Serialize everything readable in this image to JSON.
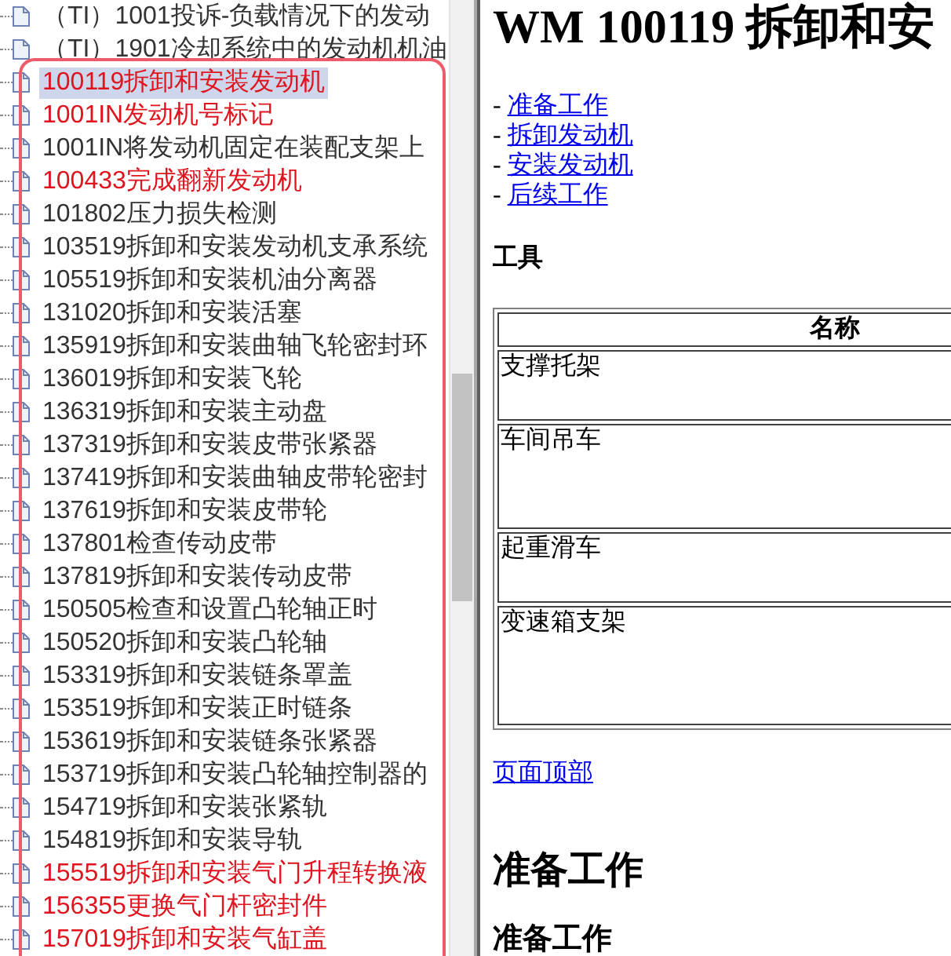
{
  "tree": {
    "items": [
      {
        "text": "（TI）1001投诉-负载情况下的发动",
        "color": "#333333",
        "selected": false
      },
      {
        "text": "（TI）1901冷却系统中的发动机机油",
        "color": "#333333",
        "selected": false
      },
      {
        "text": "100119拆卸和安装发动机",
        "color": "#e0141e",
        "selected": true
      },
      {
        "text": "1001IN发动机号标记",
        "color": "#e0141e",
        "selected": false
      },
      {
        "text": "1001IN将发动机固定在装配支架上",
        "color": "#333333",
        "selected": false
      },
      {
        "text": "100433完成翻新发动机",
        "color": "#e0141e",
        "selected": false
      },
      {
        "text": "101802压力损失检测",
        "color": "#333333",
        "selected": false
      },
      {
        "text": "103519拆卸和安装发动机支承系统",
        "color": "#333333",
        "selected": false
      },
      {
        "text": "105519拆卸和安装机油分离器",
        "color": "#333333",
        "selected": false
      },
      {
        "text": "131020拆卸和安装活塞",
        "color": "#333333",
        "selected": false
      },
      {
        "text": "135919拆卸和安装曲轴飞轮密封环",
        "color": "#333333",
        "selected": false
      },
      {
        "text": "136019拆卸和安装飞轮",
        "color": "#333333",
        "selected": false
      },
      {
        "text": "136319拆卸和安装主动盘",
        "color": "#333333",
        "selected": false
      },
      {
        "text": "137319拆卸和安装皮带张紧器",
        "color": "#333333",
        "selected": false
      },
      {
        "text": "137419拆卸和安装曲轴皮带轮密封",
        "color": "#333333",
        "selected": false
      },
      {
        "text": "137619拆卸和安装皮带轮",
        "color": "#333333",
        "selected": false
      },
      {
        "text": "137801检查传动皮带",
        "color": "#333333",
        "selected": false
      },
      {
        "text": "137819拆卸和安装传动皮带",
        "color": "#333333",
        "selected": false
      },
      {
        "text": "150505检查和设置凸轮轴正时",
        "color": "#333333",
        "selected": false
      },
      {
        "text": "150520拆卸和安装凸轮轴",
        "color": "#333333",
        "selected": false
      },
      {
        "text": "153319拆卸和安装链条罩盖",
        "color": "#333333",
        "selected": false
      },
      {
        "text": "153519拆卸和安装正时链条",
        "color": "#333333",
        "selected": false
      },
      {
        "text": "153619拆卸和安装链条张紧器",
        "color": "#333333",
        "selected": false
      },
      {
        "text": "153719拆卸和安装凸轮轴控制器的",
        "color": "#333333",
        "selected": false
      },
      {
        "text": "154719拆卸和安装张紧轨",
        "color": "#333333",
        "selected": false
      },
      {
        "text": "154819拆卸和安装导轨",
        "color": "#333333",
        "selected": false
      },
      {
        "text": "155519拆卸和安装气门升程转换液",
        "color": "#e0141e",
        "selected": false
      },
      {
        "text": "156355更换气门杆密封件",
        "color": "#e0141e",
        "selected": false
      },
      {
        "text": "157019拆卸和安装气缸盖",
        "color": "#e0141e",
        "selected": false
      }
    ]
  },
  "content": {
    "title": "WM 100119 拆卸和安",
    "toc": [
      {
        "bullet": "-",
        "link": "准备工作"
      },
      {
        "bullet": "-",
        "link": "拆卸发动机"
      },
      {
        "bullet": "-",
        "link": "安装发动机"
      },
      {
        "bullet": "-",
        "link": "后续工作"
      }
    ],
    "tools_heading": "工具",
    "tools_table": {
      "columns": [
        "名称"
      ],
      "rows": [
        [
          "支撑托架"
        ],
        [
          "车间吊车"
        ],
        [
          "起重滑车"
        ],
        [
          "变速箱支架"
        ]
      ]
    },
    "top_link": "页面顶部",
    "section_heading": "准备工作",
    "subsection_heading": "准备工作"
  }
}
